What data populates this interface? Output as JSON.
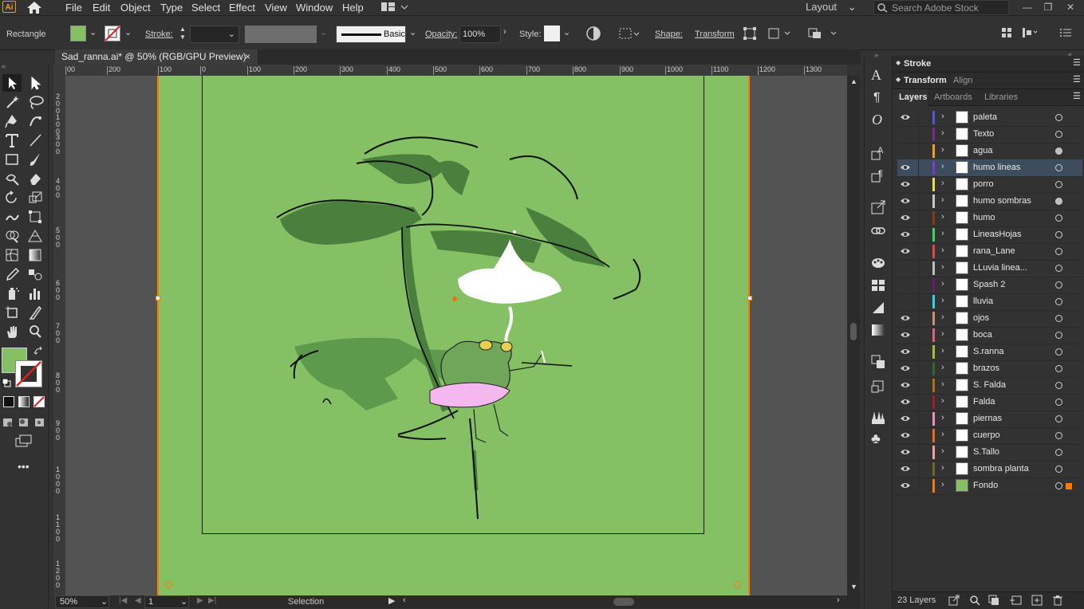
{
  "app": {
    "logo": "Ai"
  },
  "menu": [
    "File",
    "Edit",
    "Object",
    "Type",
    "Select",
    "Effect",
    "View",
    "Window",
    "Help"
  ],
  "workspace": {
    "label": "Layout"
  },
  "search": {
    "placeholder": "Search Adobe Stock"
  },
  "control_bar": {
    "tool_name": "Rectangle",
    "fill_color": "#85c065",
    "stroke_label": "Stroke:",
    "brush_label": "Basic",
    "opacity_label": "Opacity:",
    "opacity_value": "100%",
    "style_label": "Style:",
    "shape_label": "Shape:",
    "transform_label": "Transform"
  },
  "document": {
    "tab_title": "Sad_ranna.ai* @ 50% (RGB/GPU Preview)",
    "close": "×"
  },
  "rulers": {
    "h_labels": [
      "00",
      "200",
      "100",
      "0",
      "100",
      "200",
      "300",
      "400",
      "500",
      "600",
      "700",
      "800",
      "900",
      "1000",
      "1100",
      "1200",
      "1300"
    ],
    "v_labels": [
      "2 0 0",
      "1 0 0",
      "3 0 0",
      "4 0 0",
      "5 0 0",
      "6 0 0",
      "7 0 0",
      "8 0 0",
      "9 0 0",
      "1 0 0 0",
      "1 1 0 0",
      "1 2 0 0"
    ]
  },
  "status": {
    "zoom": "50%",
    "artboard_num": "1",
    "tool": "Selection"
  },
  "panels": {
    "stroke": "Stroke",
    "transform": "Transform",
    "align": "Align",
    "tabs": [
      "Layers",
      "Artboards",
      "Libraries"
    ],
    "layer_count": "23 Layers"
  },
  "layers": [
    {
      "name": "paleta",
      "color": "#4f5bd5",
      "visible": true,
      "target": "empty",
      "selected": false
    },
    {
      "name": "Texto",
      "color": "#7b2d8e",
      "visible": false,
      "target": "empty",
      "selected": false
    },
    {
      "name": "agua",
      "color": "#f0a020",
      "visible": false,
      "target": "filled",
      "selected": false
    },
    {
      "name": "humo lineas",
      "color": "#7a3bd1",
      "visible": true,
      "target": "empty",
      "selected": true
    },
    {
      "name": "porro",
      "color": "#e8e040",
      "visible": true,
      "target": "empty",
      "selected": false
    },
    {
      "name": "humo sombras",
      "color": "#c8c8c8",
      "visible": true,
      "target": "filled",
      "selected": false
    },
    {
      "name": "humo",
      "color": "#8b3a10",
      "visible": true,
      "target": "empty",
      "selected": false
    },
    {
      "name": "LineasHojas",
      "color": "#3fd45a",
      "visible": true,
      "target": "empty",
      "selected": false
    },
    {
      "name": "rana_Lane",
      "color": "#e04848",
      "visible": true,
      "target": "empty",
      "selected": false
    },
    {
      "name": "LLuvia linea...",
      "color": "#bdbdbd",
      "visible": false,
      "target": "empty",
      "selected": false
    },
    {
      "name": "Spash 2",
      "color": "#6a1a6a",
      "visible": false,
      "target": "empty",
      "selected": false
    },
    {
      "name": "lluvia",
      "color": "#2fd6e6",
      "visible": false,
      "target": "empty",
      "selected": false
    },
    {
      "name": "ojos",
      "color": "#c89070",
      "visible": true,
      "target": "empty",
      "selected": false
    },
    {
      "name": "boca",
      "color": "#e06080",
      "visible": true,
      "target": "empty",
      "selected": false
    },
    {
      "name": "S.ranna",
      "color": "#a0c030",
      "visible": true,
      "target": "empty",
      "selected": false
    },
    {
      "name": "brazos",
      "color": "#2a6a2a",
      "visible": true,
      "target": "empty",
      "selected": false
    },
    {
      "name": "S. Falda",
      "color": "#b07010",
      "visible": true,
      "target": "empty",
      "selected": false
    },
    {
      "name": "Falda",
      "color": "#a01a30",
      "visible": true,
      "target": "empty",
      "selected": false
    },
    {
      "name": "piernas",
      "color": "#f08cc0",
      "visible": true,
      "target": "empty",
      "selected": false
    },
    {
      "name": "cuerpo",
      "color": "#e07020",
      "visible": true,
      "target": "empty",
      "selected": false
    },
    {
      "name": "S.Tallo",
      "color": "#f0a0a0",
      "visible": true,
      "target": "empty",
      "selected": false
    },
    {
      "name": "sombra planta",
      "color": "#6a6a20",
      "visible": true,
      "target": "empty",
      "selected": false
    },
    {
      "name": "Fondo",
      "color": "#f07a10",
      "visible": true,
      "target": "empty",
      "selected": false
    }
  ]
}
